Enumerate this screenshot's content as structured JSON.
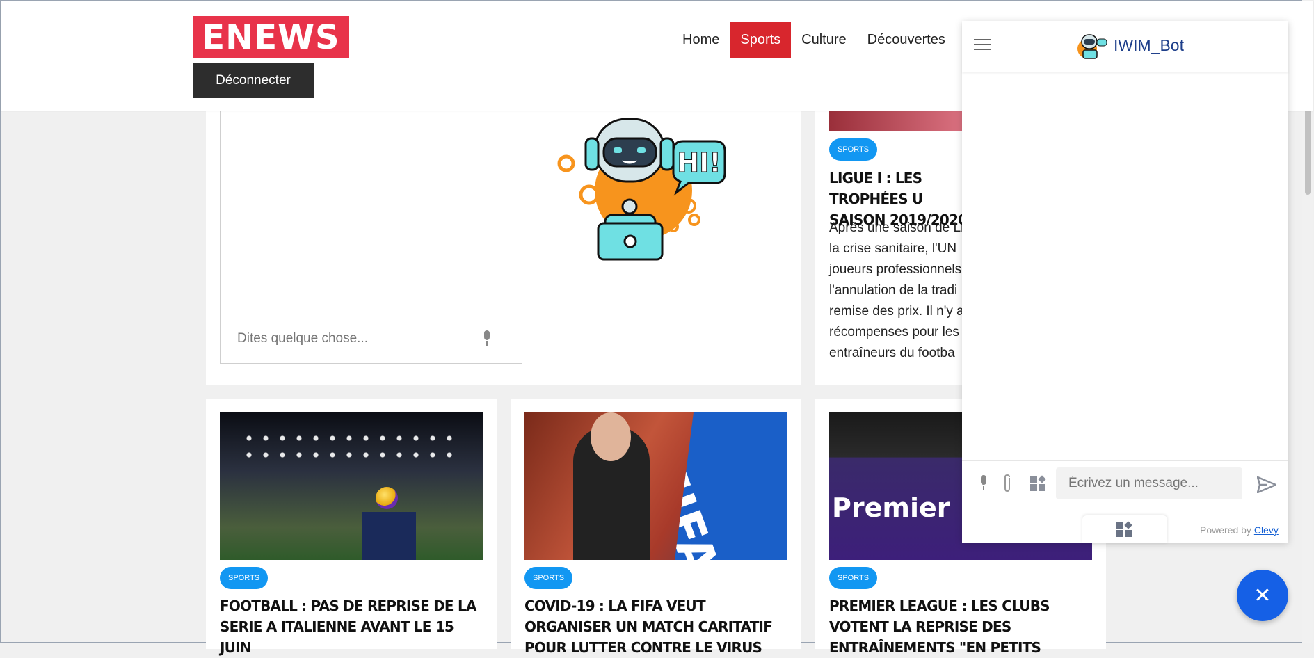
{
  "header": {
    "logo": "ENEWS",
    "logout_label": "Déconnecter",
    "nav": [
      "Home",
      "Sports",
      "Culture",
      "Découvertes"
    ],
    "active_nav": "Sports",
    "accent": "#d8262d",
    "logo_color": "#e8334a"
  },
  "embedded_chat": {
    "placeholder": "Dites quelque chose...",
    "mic_icon": "microphone-icon"
  },
  "featured_article": {
    "tag": "SPORTS",
    "title": "LIGUE I : LES TROPHÉES U SAISON 2019/2020",
    "excerpt_lines": [
      "Après une saison de Li",
      "la crise sanitaire, l'UN",
      "joueurs professionnels",
      "l'annulation de la tradi",
      "remise des prix. Il n'y a",
      "récompenses pour les",
      "entraîneurs du footba"
    ]
  },
  "articles": [
    {
      "tag": "SPORTS",
      "title": "FOOTBALL : PAS DE REPRISE DE LA SERIE A ITALIENNE AVANT LE 15 JUIN",
      "image_text": ""
    },
    {
      "tag": "SPORTS",
      "title": "COVID-19 : LA FIFA VEUT ORGANISER UN MATCH CARITATIF POUR LUTTER CONTRE LE VIRUS",
      "image_text": "FIFA"
    },
    {
      "tag": "SPORTS",
      "title": "PREMIER LEAGUE : LES CLUBS VOTENT LA REPRISE DES ENTRAÎNEMENTS \"EN PETITS",
      "image_text": "Premier"
    }
  ],
  "bot_illustration": {
    "bubble_text": "HI!"
  },
  "widget": {
    "bot_name": "IWIM_Bot",
    "input_placeholder": "Écrivez un message...",
    "powered_by": "Powered by",
    "powered_link": "Clevy",
    "brand_color": "#1560e6"
  },
  "fab": {
    "icon": "close-icon"
  }
}
